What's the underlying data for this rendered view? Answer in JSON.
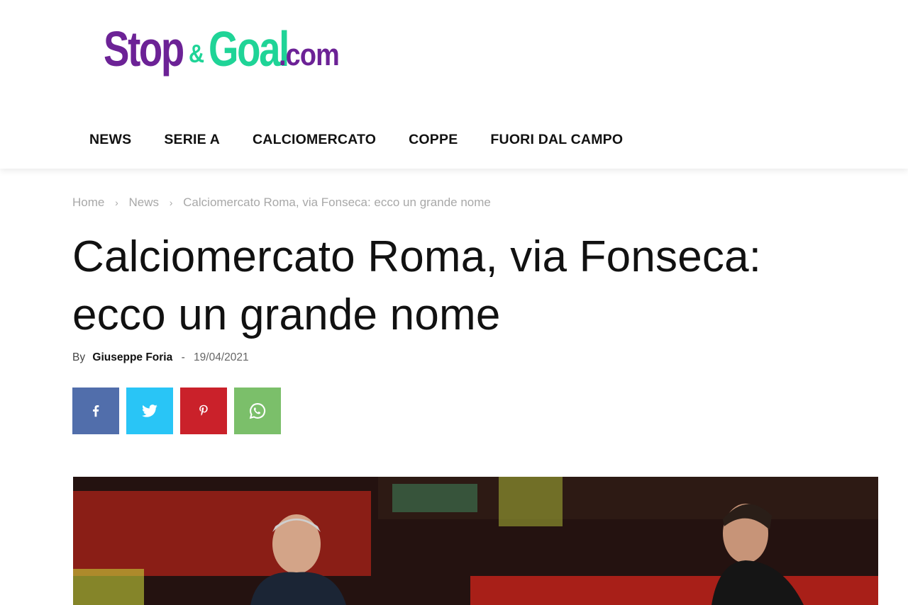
{
  "logo": {
    "part1": "Stop",
    "part2": "&",
    "part3": "Goal",
    "part4": ".com"
  },
  "nav": {
    "items": [
      "NEWS",
      "SERIE A",
      "CALCIOMERCATO",
      "COPPE",
      "FUORI DAL CAMPO"
    ]
  },
  "breadcrumb": {
    "home": "Home",
    "section": "News",
    "current": "Calciomercato Roma, via Fonseca: ecco un grande nome",
    "separator": "›"
  },
  "article": {
    "title": "Calciomercato Roma, via Fonseca: ecco un grande nome",
    "by_label": "By",
    "author": "Giuseppe Foria",
    "separator": "-",
    "date": "19/04/2021"
  },
  "share": {
    "icons": [
      "facebook-icon",
      "twitter-icon",
      "pinterest-icon",
      "whatsapp-icon"
    ]
  },
  "colors": {
    "brand_purple": "#6c2296",
    "brand_green": "#1fd497",
    "facebook": "#516eab",
    "twitter": "#29c5f6",
    "pinterest": "#ca212a",
    "whatsapp": "#7bbf6a"
  }
}
